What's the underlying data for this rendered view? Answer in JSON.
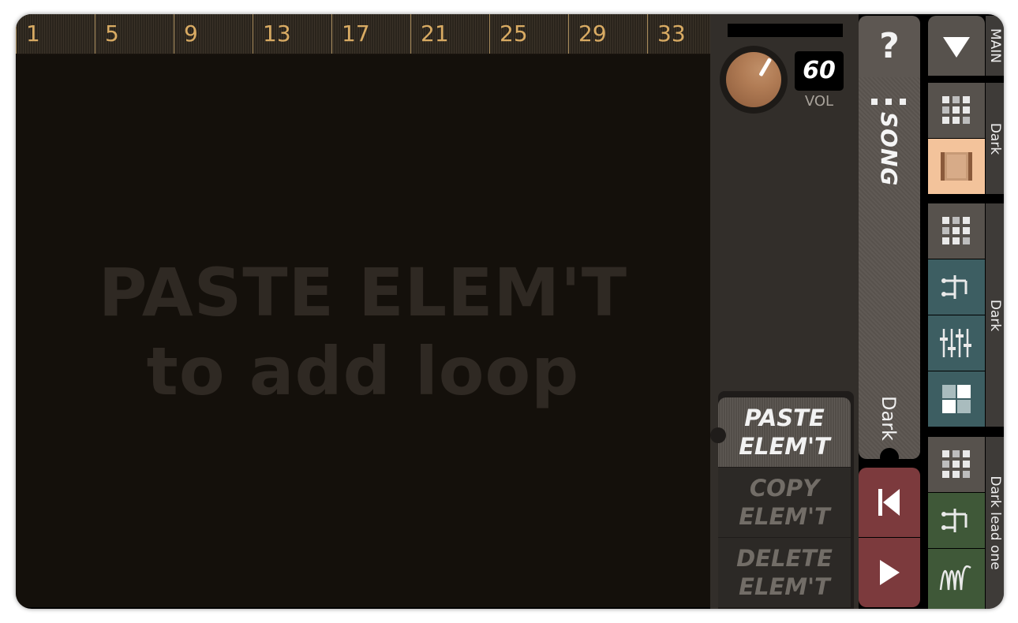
{
  "ruler": {
    "bars": [
      "1",
      "5",
      "9",
      "13",
      "17",
      "21",
      "25",
      "29",
      "33"
    ]
  },
  "timeline": {
    "hint_line1": "PASTE ELEM'T",
    "hint_line2": "to add loop"
  },
  "tempo": {
    "value": "60",
    "volume_label": "VOL"
  },
  "element_buttons": {
    "paste": {
      "line1": "PASTE",
      "line2": "ELEM'T"
    },
    "copy": {
      "line1": "COPY",
      "line2": "ELEM'T"
    },
    "delete": {
      "line1": "DELETE",
      "line2": "ELEM'T"
    }
  },
  "song_tab": {
    "help": "?",
    "title": "SONG",
    "subtitle": "Dark"
  },
  "right_strip": {
    "main_label": "MAIN",
    "group_labels": [
      "Dark",
      "Dark",
      "Dark lead one"
    ]
  },
  "colors": {
    "accent": "#d9ab63",
    "transport": "#7c3a3d",
    "selected": "#f3c39b",
    "teal": "#3d5e62",
    "green": "#3f5838"
  }
}
